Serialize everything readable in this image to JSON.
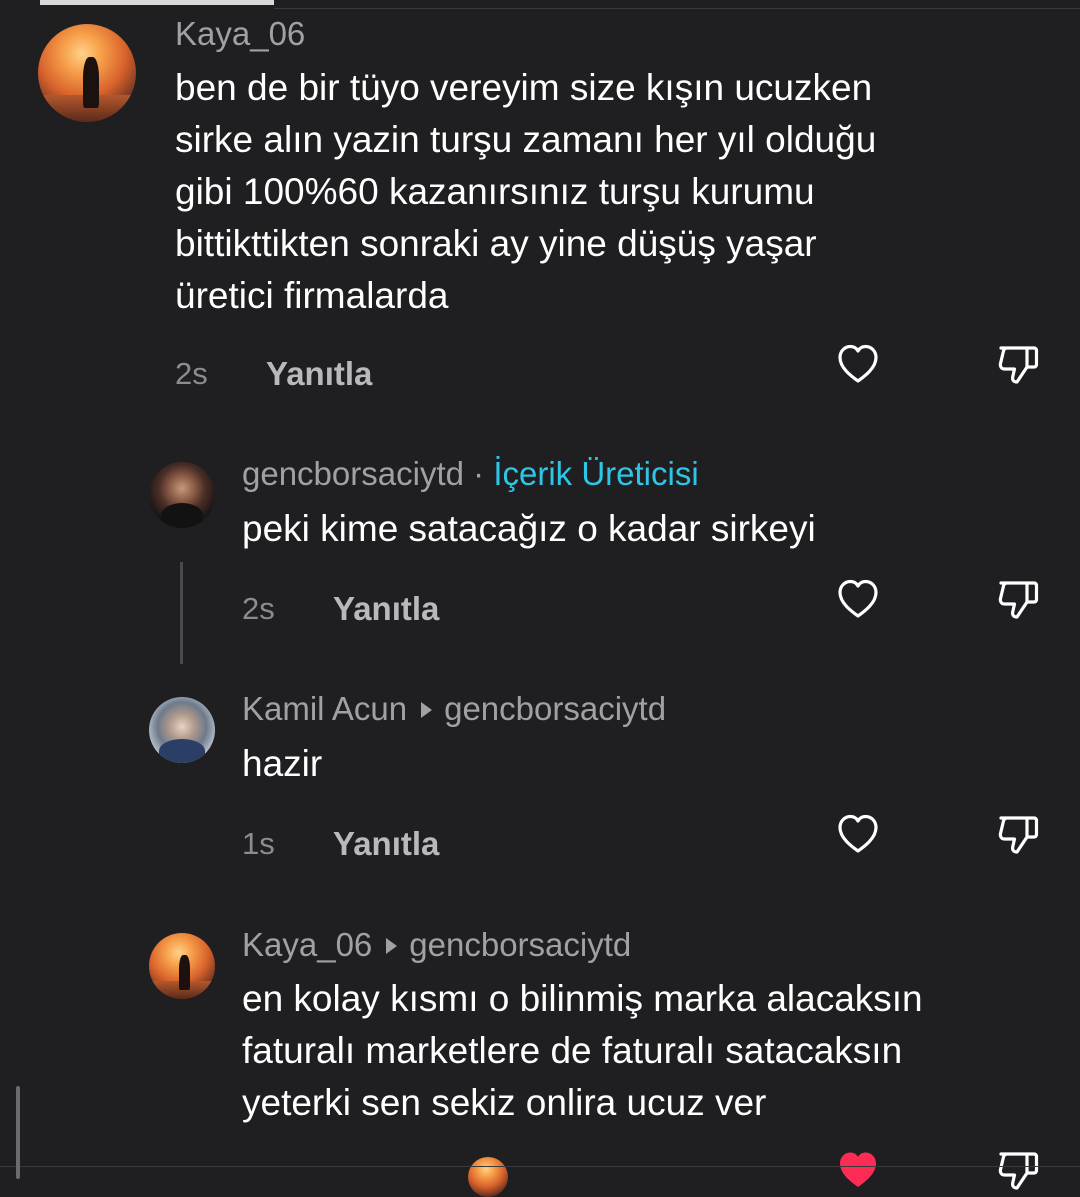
{
  "comments": [
    {
      "username": "Kaya_06",
      "text_lines": [
        "ben de bir tüyo vereyim size kışın ucuzken",
        "sirke alın yazin turşu zamanı her yıl olduğu",
        "gibi 100%60 kazanırsınız turşu kurumu",
        "bittikttikten sonraki ay yine düşüş yaşar",
        "üretici firmalarda"
      ],
      "time": "2s",
      "reply": "Yanıtla"
    },
    {
      "username": "gencborsaciytd",
      "separator": "·",
      "badge": "İçerik Üreticisi",
      "text": "peki kime satacağız o kadar sirkeyi",
      "time": "2s",
      "reply": "Yanıtla"
    },
    {
      "username": "Kamil Acun",
      "reply_to": "gencborsaciytd",
      "text": "hazir",
      "time": "1s",
      "reply": "Yanıtla"
    },
    {
      "username": "Kaya_06",
      "reply_to": "gencborsaciytd",
      "text_lines": [
        "en kolay kısmı o bilinmiş marka alacaksın",
        "faturalı marketlere de faturalı satacaksın",
        "yeterki sen sekiz onlira ucuz ver"
      ]
    }
  ],
  "icons": {
    "like": "heart-outline-icon",
    "dislike": "thumbs-down-icon",
    "liked": "heart-filled-icon"
  },
  "colors": {
    "background": "#1f1f21",
    "badge": "#2ec6e6",
    "liked": "#fe2c55"
  }
}
